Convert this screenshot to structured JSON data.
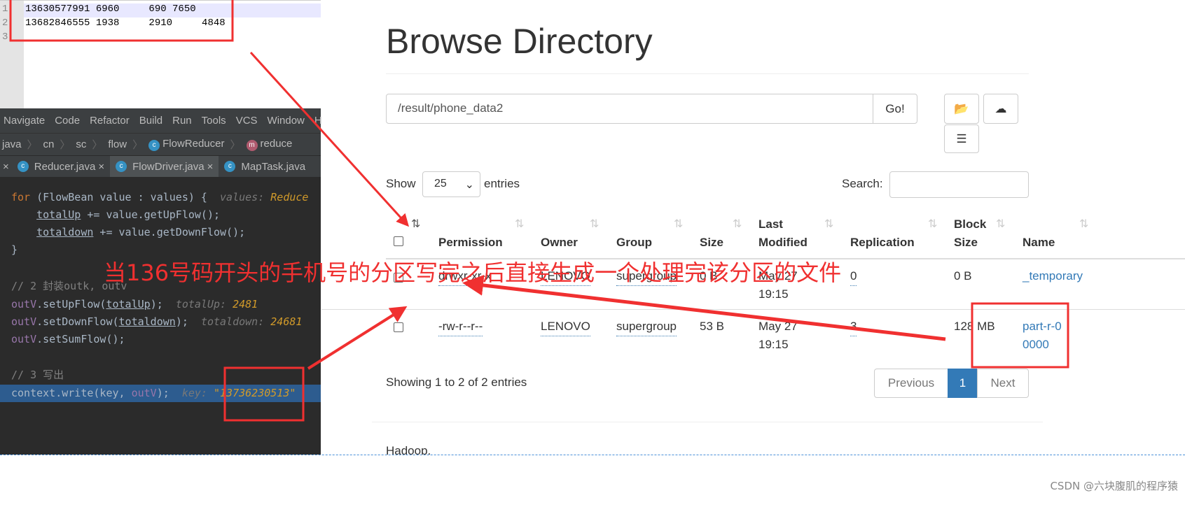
{
  "notepad": {
    "lines": [
      {
        "n": "1",
        "text": "13630577991 6960     690 7650"
      },
      {
        "n": "2",
        "text": "13682846555 1938     2910     4848"
      },
      {
        "n": "3",
        "text": ""
      }
    ]
  },
  "ide": {
    "menu": [
      "Navigate",
      "Code",
      "Refactor",
      "Build",
      "Run",
      "Tools",
      "VCS",
      "Window",
      "H"
    ],
    "breadcrumb": [
      "java",
      "cn",
      "sc",
      "flow",
      "FlowReducer",
      "reduce"
    ],
    "tabs": [
      "Reducer.java",
      "FlowDriver.java",
      "MapTask.java"
    ],
    "code": {
      "l1a": "for",
      "l1b": " (FlowBean value : values) {",
      "l1h": "values: ",
      "l1v": "Reduce",
      "l2a": "totalUp",
      "l2b": " += value.getUpFlow();",
      "l3a": "totaldown",
      "l3b": " += value.getDownFlow();",
      "l4": "}",
      "l5": "// 2 封装outk, outv",
      "l6a": "outV",
      "l6b": ".setUpFlow(",
      "l6c": "totalUp",
      "l6d": ");",
      "l6h": "totalUp: ",
      "l6v": "2481",
      "l7a": "outV",
      "l7b": ".setDownFlow(",
      "l7c": "totaldown",
      "l7d": ");",
      "l7h": "totaldown: ",
      "l7v": "24681",
      "l8a": "outV",
      "l8b": ".setSumFlow();",
      "l9": "// 3 写出",
      "l10a": "context.write(key, ",
      "l10b": "outV",
      "l10c": ");",
      "l10h": "key: ",
      "l10v": "\"13736230513\""
    }
  },
  "hdfs": {
    "title": "Browse Directory",
    "path": "/result/phone_data2",
    "go": "Go!",
    "show": "Show",
    "entries_value": "25",
    "entries": "entries",
    "search": "Search:",
    "columns": [
      "Permission",
      "Owner",
      "Group",
      "Size",
      "Last Modified",
      "Replication",
      "Block Size",
      "Name"
    ],
    "rows": [
      {
        "perm": "drwxr-xr-x",
        "owner": "LENOVO",
        "group": "supergroup",
        "size": "0 B",
        "mod1": "May 27",
        "mod2": "19:15",
        "rep": "0",
        "block": "0 B",
        "name": "_temporary"
      },
      {
        "perm": "-rw-r--r--",
        "owner": "LENOVO",
        "group": "supergroup",
        "size": "53 B",
        "mod1": "May 27",
        "mod2": "19:15",
        "rep": "3",
        "block": "128 MB",
        "name": "part-r-00000"
      }
    ],
    "info": "Showing 1 to 2 of 2 entries",
    "prev": "Previous",
    "page": "1",
    "next": "Next",
    "footer": "Hadoop,"
  },
  "annotation": "当136号码开头的手机号的分区写完之后直接生成一个处理完该分区的文件",
  "watermark": "CSDN @六块腹肌的程序猿",
  "colors": {
    "annotation": "#f03030",
    "link": "#337ab7",
    "ide_bg": "#2b2b2b",
    "selection": "#2d5c8f"
  }
}
